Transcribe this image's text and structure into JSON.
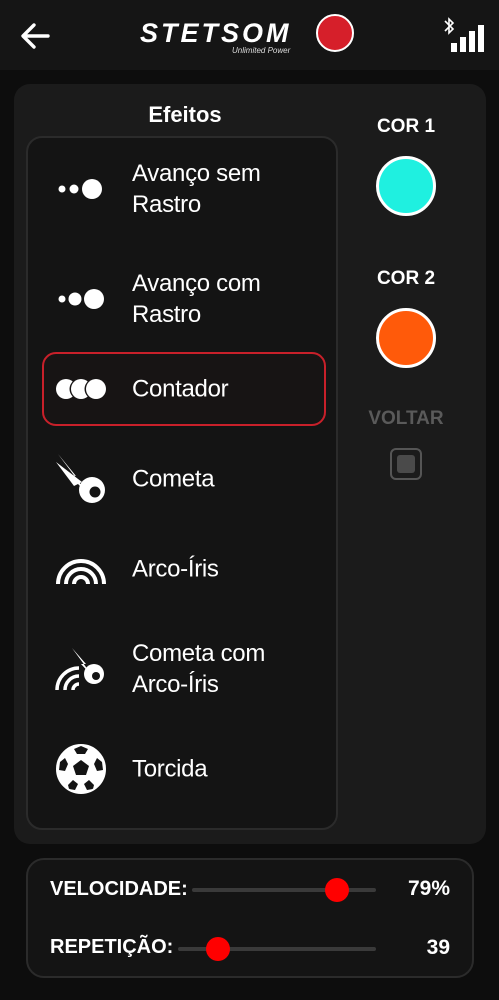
{
  "header": {
    "back_icon": "arrow-left-icon",
    "logo_text": "STETSOM",
    "logo_sub": "Unlimited Power",
    "bluetooth_icon": "bluetooth-icon",
    "signal_icon": "signal-bars-icon"
  },
  "effects": {
    "title": "Efeitos",
    "items": [
      {
        "label": "Avanço sem\nRastro",
        "icon": "dots-advance-icon",
        "selected": false
      },
      {
        "label": "Avanço com\nRastro",
        "icon": "dots-trail-icon",
        "selected": false
      },
      {
        "label": "Contador",
        "icon": "counter-circles-icon",
        "selected": true
      },
      {
        "label": "Cometa",
        "icon": "comet-icon",
        "selected": false
      },
      {
        "label": "Arco-Íris",
        "icon": "rainbow-icon",
        "selected": false
      },
      {
        "label": "Cometa com\nArco-Íris",
        "icon": "comet-rainbow-icon",
        "selected": false
      },
      {
        "label": "Torcida",
        "icon": "soccer-ball-icon",
        "selected": false
      }
    ]
  },
  "colors": {
    "cor1": {
      "label": "COR 1",
      "value": "#1ff0e0"
    },
    "cor2": {
      "label": "COR 2",
      "value": "#ff5a0a"
    },
    "accent": "#c8202a",
    "slider_thumb": "#ff0000"
  },
  "voltar": {
    "label": "VOLTAR",
    "checked": false,
    "enabled": false
  },
  "sliders": {
    "velocidade": {
      "label": "VELOCIDADE:",
      "value": "79%",
      "fraction": 0.79
    },
    "repeticao": {
      "label": "REPETIÇÃO:",
      "value": "39",
      "fraction": 0.2
    }
  }
}
